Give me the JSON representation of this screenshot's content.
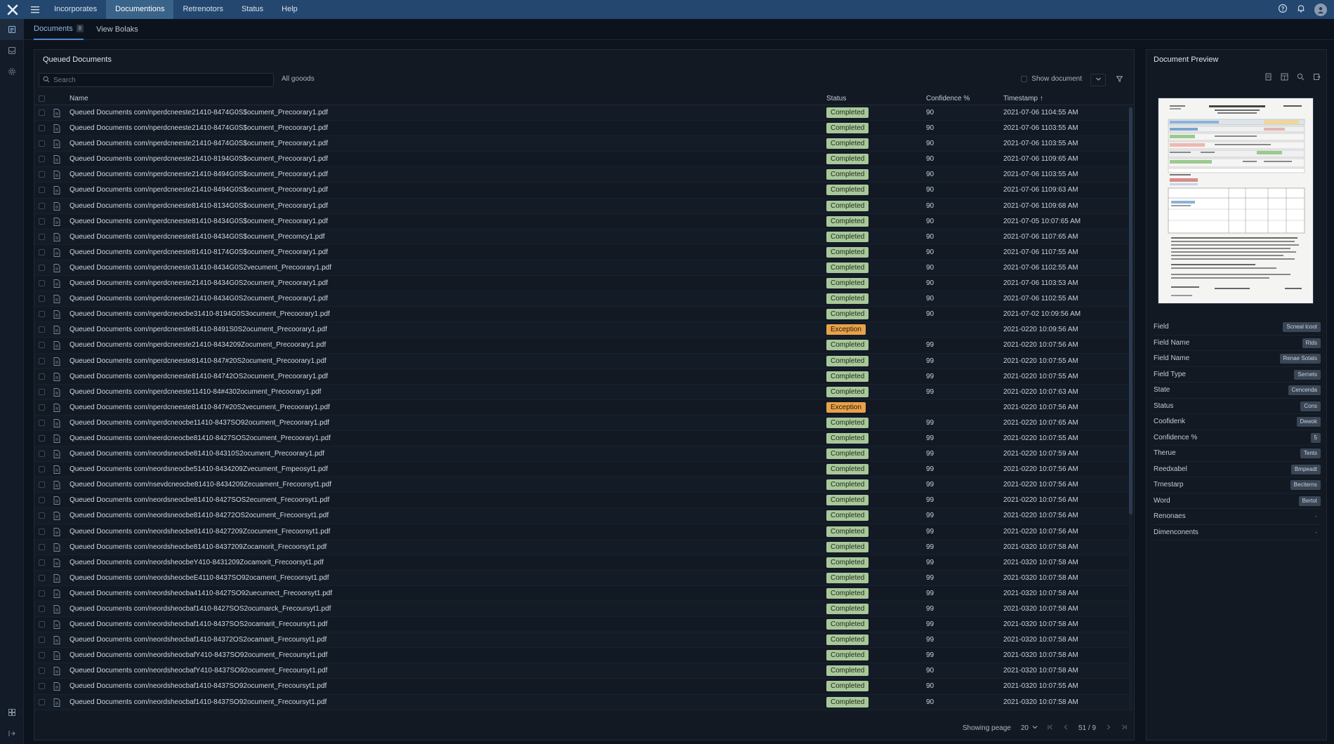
{
  "nav": {
    "items": [
      "Incorporates",
      "Documentions",
      "Retrenotors",
      "Status",
      "Help"
    ],
    "active_index": 1
  },
  "subtabs": [
    {
      "label": "Documents",
      "badge": "8"
    },
    {
      "label": "View Bolaks"
    }
  ],
  "main": {
    "title": "Queued Documents",
    "search_placeholder": "Search",
    "filter_label": "All gooods",
    "show_document_label": "Show document",
    "columns": {
      "name": "Name",
      "status": "Status",
      "confidence": "Confidence %",
      "timestamp": "Timestamp ↑"
    },
    "rows": [
      {
        "name": "Queued Documents com/nperdcneeste21410-8474G0S$ocument_Precoorary1.pdf",
        "status": "Completed",
        "conf": "90",
        "time": "2021-07-06 1104:55 AM"
      },
      {
        "name": "Queued Documents com/nperdcneeste21410-8474G0S$ocument_Precoorary1.pdf",
        "status": "Completed",
        "conf": "90",
        "time": "2021-07-06 1103:55 AM"
      },
      {
        "name": "Queued Documents com/nperdcneeste21410-8474G0S$ocument_Precoorary1.pdf",
        "status": "Completed",
        "conf": "90",
        "time": "2021-07-06 1103:55 AM"
      },
      {
        "name": "Queued Documents com/nperdcneeste21410-8194G0S$ocument_Precoorary1.pdf",
        "status": "Completed",
        "conf": "90",
        "time": "2021-07-06 1109:65 AM"
      },
      {
        "name": "Queued Documents com/nperdcneeste21410-8494G0S$ocument_Precoorary1.pdf",
        "status": "Completed",
        "conf": "90",
        "time": "2021-07-06 1103:55 AM"
      },
      {
        "name": "Queued Documents com/nperdcneeste21410-8494G0S$ocument_Precoorary1.pdf",
        "status": "Completed",
        "conf": "90",
        "time": "2021-07-06 1109:63 AM"
      },
      {
        "name": "Queued Documents com/nperdcneeste81410-8134G0S$ocument_Precoorary1.pdf",
        "status": "Completed",
        "conf": "90",
        "time": "2021-07-06 1109:68 AM"
      },
      {
        "name": "Queued Documents com/nperdcneeste81410-8434G0S$ocument_Precoorary1.pdf",
        "status": "Completed",
        "conf": "90",
        "time": "2021-07-05 10:07:65 AM"
      },
      {
        "name": "Queued Documents com/nperdcneeste81410-8434G0S$ocument_Precomcy1.pdf",
        "status": "Completed",
        "conf": "90",
        "time": "2021-07-06 1107:65 AM"
      },
      {
        "name": "Queued Documents com/nperdcneeste81410-8174G0S$ocument_Precoorary1.pdf",
        "status": "Completed",
        "conf": "90",
        "time": "2021-07-06 1107:55 AM"
      },
      {
        "name": "Queued Documents com/nperdcneeste31410-8434G0S2vecument_Precoorary1.pdf",
        "status": "Completed",
        "conf": "90",
        "time": "2021-07-06 1102:55 AM"
      },
      {
        "name": "Queued Documents com/nperdcneeste21410-8434G0S2ocument_Precoorary1.pdf",
        "status": "Completed",
        "conf": "90",
        "time": "2021-07-06 1103:53 AM"
      },
      {
        "name": "Queued Documents com/nperdcneeste21410-8434G0S2ocument_Precoorary1.pdf",
        "status": "Completed",
        "conf": "90",
        "time": "2021-07-06 1102:55 AM"
      },
      {
        "name": "Queued Documents com/nperdcneocbe31410-8194G0S3ocument_Precoorary1.pdf",
        "status": "Completed",
        "conf": "90",
        "time": "2021-07-02 10:09:56 AM"
      },
      {
        "name": "Queued Documents com/nperdcneeste81410-8491S0S2ocument_Precoorary1.pdf",
        "status": "Exception",
        "conf": "",
        "time": "2021-0220 10:09:56 AM"
      },
      {
        "name": "Queued Documents com/nperdcneeste21410-8434209Zocument_Precoorary1.pdf",
        "status": "Completed",
        "conf": "99",
        "time": "2021-0220 10:07:56 AM"
      },
      {
        "name": "Queued Documents com/nperdcneeste81410-847#20S2ocument_Precoorary1.pdf",
        "status": "Completed",
        "conf": "99",
        "time": "2021-0220 10:07:55 AM"
      },
      {
        "name": "Queued Documents com/nperdcneeste81410-84742OS2ocument_Precoorary1.pdf",
        "status": "Completed",
        "conf": "99",
        "time": "2021-0220 10:07:55 AM"
      },
      {
        "name": "Queued Documents com/nperdcneeste11410-84#4302ocument_Precoorary1.pdf",
        "status": "Completed",
        "conf": "99",
        "time": "2021-0220 10:07:63 AM"
      },
      {
        "name": "Queued Documents com/nperdcneeste81410-847#20S2vecument_Precoorary1.pdf",
        "status": "Exception",
        "conf": "",
        "time": "2021-0220 10:07:56 AM"
      },
      {
        "name": "Queued Documents com/nperdcneocbe11410-8437SO92ocument_Precoorary1.pdf",
        "status": "Completed",
        "conf": "99",
        "time": "2021-0220 10:07:65 AM"
      },
      {
        "name": "Queued Documents com/neerdcneocbe81410-8427SOS2ocument_Precoorary1.pdf",
        "status": "Completed",
        "conf": "99",
        "time": "2021-0220 10:07:55 AM"
      },
      {
        "name": "Queued Documents com/neordsneocbe81410-84310S2ocument_Precoorary1.pdf",
        "status": "Completed",
        "conf": "99",
        "time": "2021-0220 10:07:59 AM"
      },
      {
        "name": "Queued Documents com/neordsneocbe51410-8434209Zvecument_Fmpeosyt1.pdf",
        "status": "Completed",
        "conf": "99",
        "time": "2021-0220 10:07:56 AM"
      },
      {
        "name": "Queued Documents com/nsevdcneocbe81410-8434209Zecuament_Frecoorsyt1.pdf",
        "status": "Completed",
        "conf": "99",
        "time": "2021-0220 10:07:56 AM"
      },
      {
        "name": "Queued Documents com/neordsneocbe81410-8427SOS2ecument_Frecoorsyt1.pdf",
        "status": "Completed",
        "conf": "99",
        "time": "2021-0220 10:07:56 AM"
      },
      {
        "name": "Queued Documents com/neordsneocbe81410-84272OS2ocument_Frecoorsyt1.pdf",
        "status": "Completed",
        "conf": "99",
        "time": "2021-0220 10:07:56 AM"
      },
      {
        "name": "Queued Documents com/neordsheocbe81410-8427209Zcocument_Frecoorsyt1.pdf",
        "status": "Completed",
        "conf": "99",
        "time": "2021-0220 10:07:56 AM"
      },
      {
        "name": "Queued Documents com/neordsheocbe81410-8437209Zocamorit_Frecoorsyt1.pdf",
        "status": "Completed",
        "conf": "99",
        "time": "2021-0320 10:07:58 AM"
      },
      {
        "name": "Queued Documents com/neordsheocbeY410-8431209Zocamorit_Frecoorsyt1.pdf",
        "status": "Completed",
        "conf": "99",
        "time": "2021-0320 10:07:58 AM"
      },
      {
        "name": "Queued Documents com/neordsheocbeE4110-8437SO92ocament_Frecoorsyt1.pdf",
        "status": "Completed",
        "conf": "99",
        "time": "2021-0320 10:07:58 AM"
      },
      {
        "name": "Queued Documents com/neordsheocba41410-8427SO92uecumect_Frecoorsyt1.pdf",
        "status": "Completed",
        "conf": "99",
        "time": "2021-0320 10:07:58 AM"
      },
      {
        "name": "Queued Documents com/neordsheocbaf1410-8427SOS2ocumarck_Frecoursyt1.pdf",
        "status": "Completed",
        "conf": "99",
        "time": "2021-0320 10:07:58 AM"
      },
      {
        "name": "Queued Documents com/neordsheocbaf1410-8437SOS2ocamarit_Frecoursyt1.pdf",
        "status": "Completed",
        "conf": "99",
        "time": "2021-0320 10:07:58 AM"
      },
      {
        "name": "Queued Documents com/neordsheocbaf1410-84372OS2ocamarit_Frecoursyt1.pdf",
        "status": "Completed",
        "conf": "99",
        "time": "2021-0320 10:07:58 AM"
      },
      {
        "name": "Queued Documents com/neordsheocbafY410-8437SO92ocument_Frecoursyt1.pdf",
        "status": "Completed",
        "conf": "99",
        "time": "2021-0320 10:07:58 AM"
      },
      {
        "name": "Queued Documents com/neordsheocbafY410-8437SO92ocument_Frecoursyt1.pdf",
        "status": "Completed",
        "conf": "90",
        "time": "2021-0320 10:07:58 AM"
      },
      {
        "name": "Queued Documents com/neordsheocbaf1410-8437SO92ocument_Frecoursyt1.pdf",
        "status": "Completed",
        "conf": "90",
        "time": "2021-0320 10:07:55 AM"
      },
      {
        "name": "Queued Documents com/neordsheocbaf1410-8437SO92ocument_Frecoursyt1.pdf",
        "status": "Completed",
        "conf": "90",
        "time": "2021-0320 10:07:58 AM"
      }
    ],
    "pager": {
      "showing_label": "Showing peage",
      "page_size": "20",
      "position": "51 / 9"
    }
  },
  "preview": {
    "title": "Document Preview",
    "fields": [
      {
        "key": "Field",
        "value": "Scneal lcoot"
      },
      {
        "key": "Field Name",
        "value": "Rtds"
      },
      {
        "key": "Field Name",
        "value": "Renae Sotats"
      },
      {
        "key": "Field Type",
        "value": "Sernets"
      },
      {
        "key": "State",
        "value": "Cencenda"
      },
      {
        "key": "Status",
        "value": "Cons"
      },
      {
        "key": "Coofidenk",
        "value": "Dewok"
      },
      {
        "key": "Confidence %",
        "value": "5"
      },
      {
        "key": "Therue",
        "value": "Tents"
      },
      {
        "key": "Reedxabel",
        "value": "Bmpeadt"
      },
      {
        "key": "Trnestarp",
        "value": "Beciterns"
      },
      {
        "key": "Word",
        "value": "Bertot"
      },
      {
        "key": "Renonaes",
        "value": "-",
        "plain": true
      },
      {
        "key": "Dimenconents",
        "value": "-",
        "plain": true
      }
    ]
  },
  "colors": {
    "topbar": "#23476e",
    "accent": "#4d86c4",
    "completed": "#a8c89a",
    "exception": "#e8a24a"
  },
  "icons": [
    "app-logo-icon",
    "hamburger-icon",
    "help-icon",
    "bell-icon",
    "user-avatar-icon",
    "search-icon",
    "filter-icon",
    "chevron-down-icon",
    "file-icon"
  ]
}
